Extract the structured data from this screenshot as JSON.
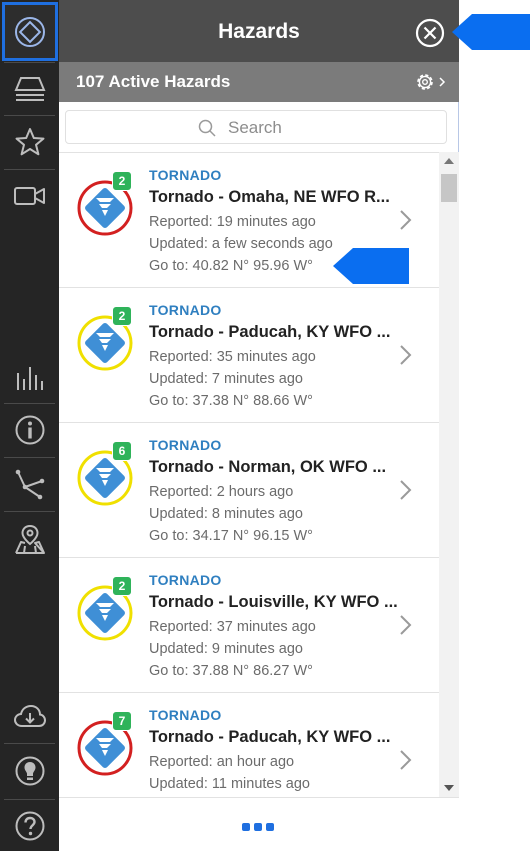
{
  "header": {
    "title": "Hazards"
  },
  "subheader": {
    "count_label": "107 Active Hazards"
  },
  "search": {
    "placeholder": "Search"
  },
  "colors": {
    "accent": "#1f6fe0",
    "category": "#2f7fc0",
    "badge": "#2fb35a",
    "ring_red": "#d32020",
    "ring_yellow": "#f0e000"
  },
  "hazards": [
    {
      "category": "TORNADO",
      "title": "Tornado - Omaha, NE WFO R...",
      "reported": "Reported: 19 minutes ago",
      "updated": "Updated: a few seconds ago",
      "goto": "Go to: 40.82 N° 95.96 W°",
      "badge": "2",
      "ring": "red"
    },
    {
      "category": "TORNADO",
      "title": "Tornado - Paducah, KY WFO ...",
      "reported": "Reported: 35 minutes ago",
      "updated": "Updated: 7 minutes ago",
      "goto": "Go to: 37.38 N° 88.66 W°",
      "badge": "2",
      "ring": "yellow"
    },
    {
      "category": "TORNADO",
      "title": "Tornado - Norman, OK WFO ...",
      "reported": "Reported: 2 hours ago",
      "updated": "Updated: 8 minutes ago",
      "goto": "Go to: 34.17 N° 96.15 W°",
      "badge": "6",
      "ring": "yellow"
    },
    {
      "category": "TORNADO",
      "title": "Tornado - Louisville, KY WFO ...",
      "reported": "Reported: 37 minutes ago",
      "updated": "Updated: 9 minutes ago",
      "goto": "Go to: 37.88 N° 86.27 W°",
      "badge": "2",
      "ring": "yellow"
    },
    {
      "category": "TORNADO",
      "title": "Tornado - Paducah, KY WFO ...",
      "reported": "Reported: an hour ago",
      "updated": "Updated: 11 minutes ago",
      "goto": "",
      "badge": "7",
      "ring": "red"
    }
  ],
  "icons": {
    "rail": [
      "hazards-icon",
      "layers-icon",
      "star-icon",
      "video-camera-icon",
      "bar-chart-icon",
      "info-icon",
      "graph-icon",
      "map-pin-icon",
      "cloud-download-icon",
      "bulb-icon",
      "help-icon"
    ],
    "header_close": "close-circle-icon",
    "settings": "gear-icon",
    "search": "search-icon",
    "more": "more-dots-icon"
  }
}
